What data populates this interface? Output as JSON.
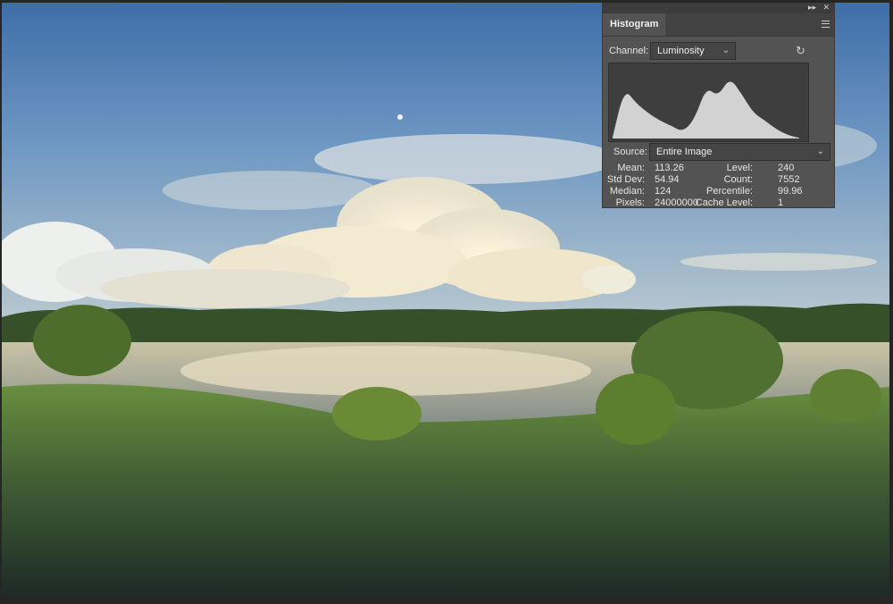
{
  "panel": {
    "tab_label": "Histogram",
    "channel_label": "Channel:",
    "channel_value": "Luminosity",
    "source_label": "Source:",
    "source_value": "Entire Image"
  },
  "stats": {
    "mean_label": "Mean:",
    "mean": "113.26",
    "std_label": "Std Dev:",
    "std": "54.94",
    "median_label": "Median:",
    "median": "124",
    "pixels_label": "Pixels:",
    "pixels": "24000000",
    "level_label": "Level:",
    "level": "240",
    "count_label": "Count:",
    "count": "7552",
    "percentile_label": "Percentile:",
    "percentile": "99.96",
    "cache_label": "Cache Level:",
    "cache": "1"
  },
  "icons": {
    "collapse": "double-chevron-icon",
    "close": "close-icon",
    "menu": "panel-menu-icon",
    "refresh": "refresh-icon",
    "dropdown": "chevron-down-icon"
  },
  "colors": {
    "panel_bg": "#535353",
    "histogram_fill": "#d2d2d2",
    "histogram_bg": "#3e3e3e"
  },
  "histogram": {
    "levels": [
      0,
      16,
      32,
      48,
      64,
      80,
      96,
      112,
      128,
      144,
      160,
      176,
      192,
      208,
      224,
      240,
      255
    ],
    "relative_counts": [
      0.02,
      0.78,
      0.55,
      0.4,
      0.28,
      0.2,
      0.1,
      0.3,
      0.8,
      0.65,
      0.95,
      0.7,
      0.4,
      0.28,
      0.14,
      0.05,
      0.01
    ]
  }
}
